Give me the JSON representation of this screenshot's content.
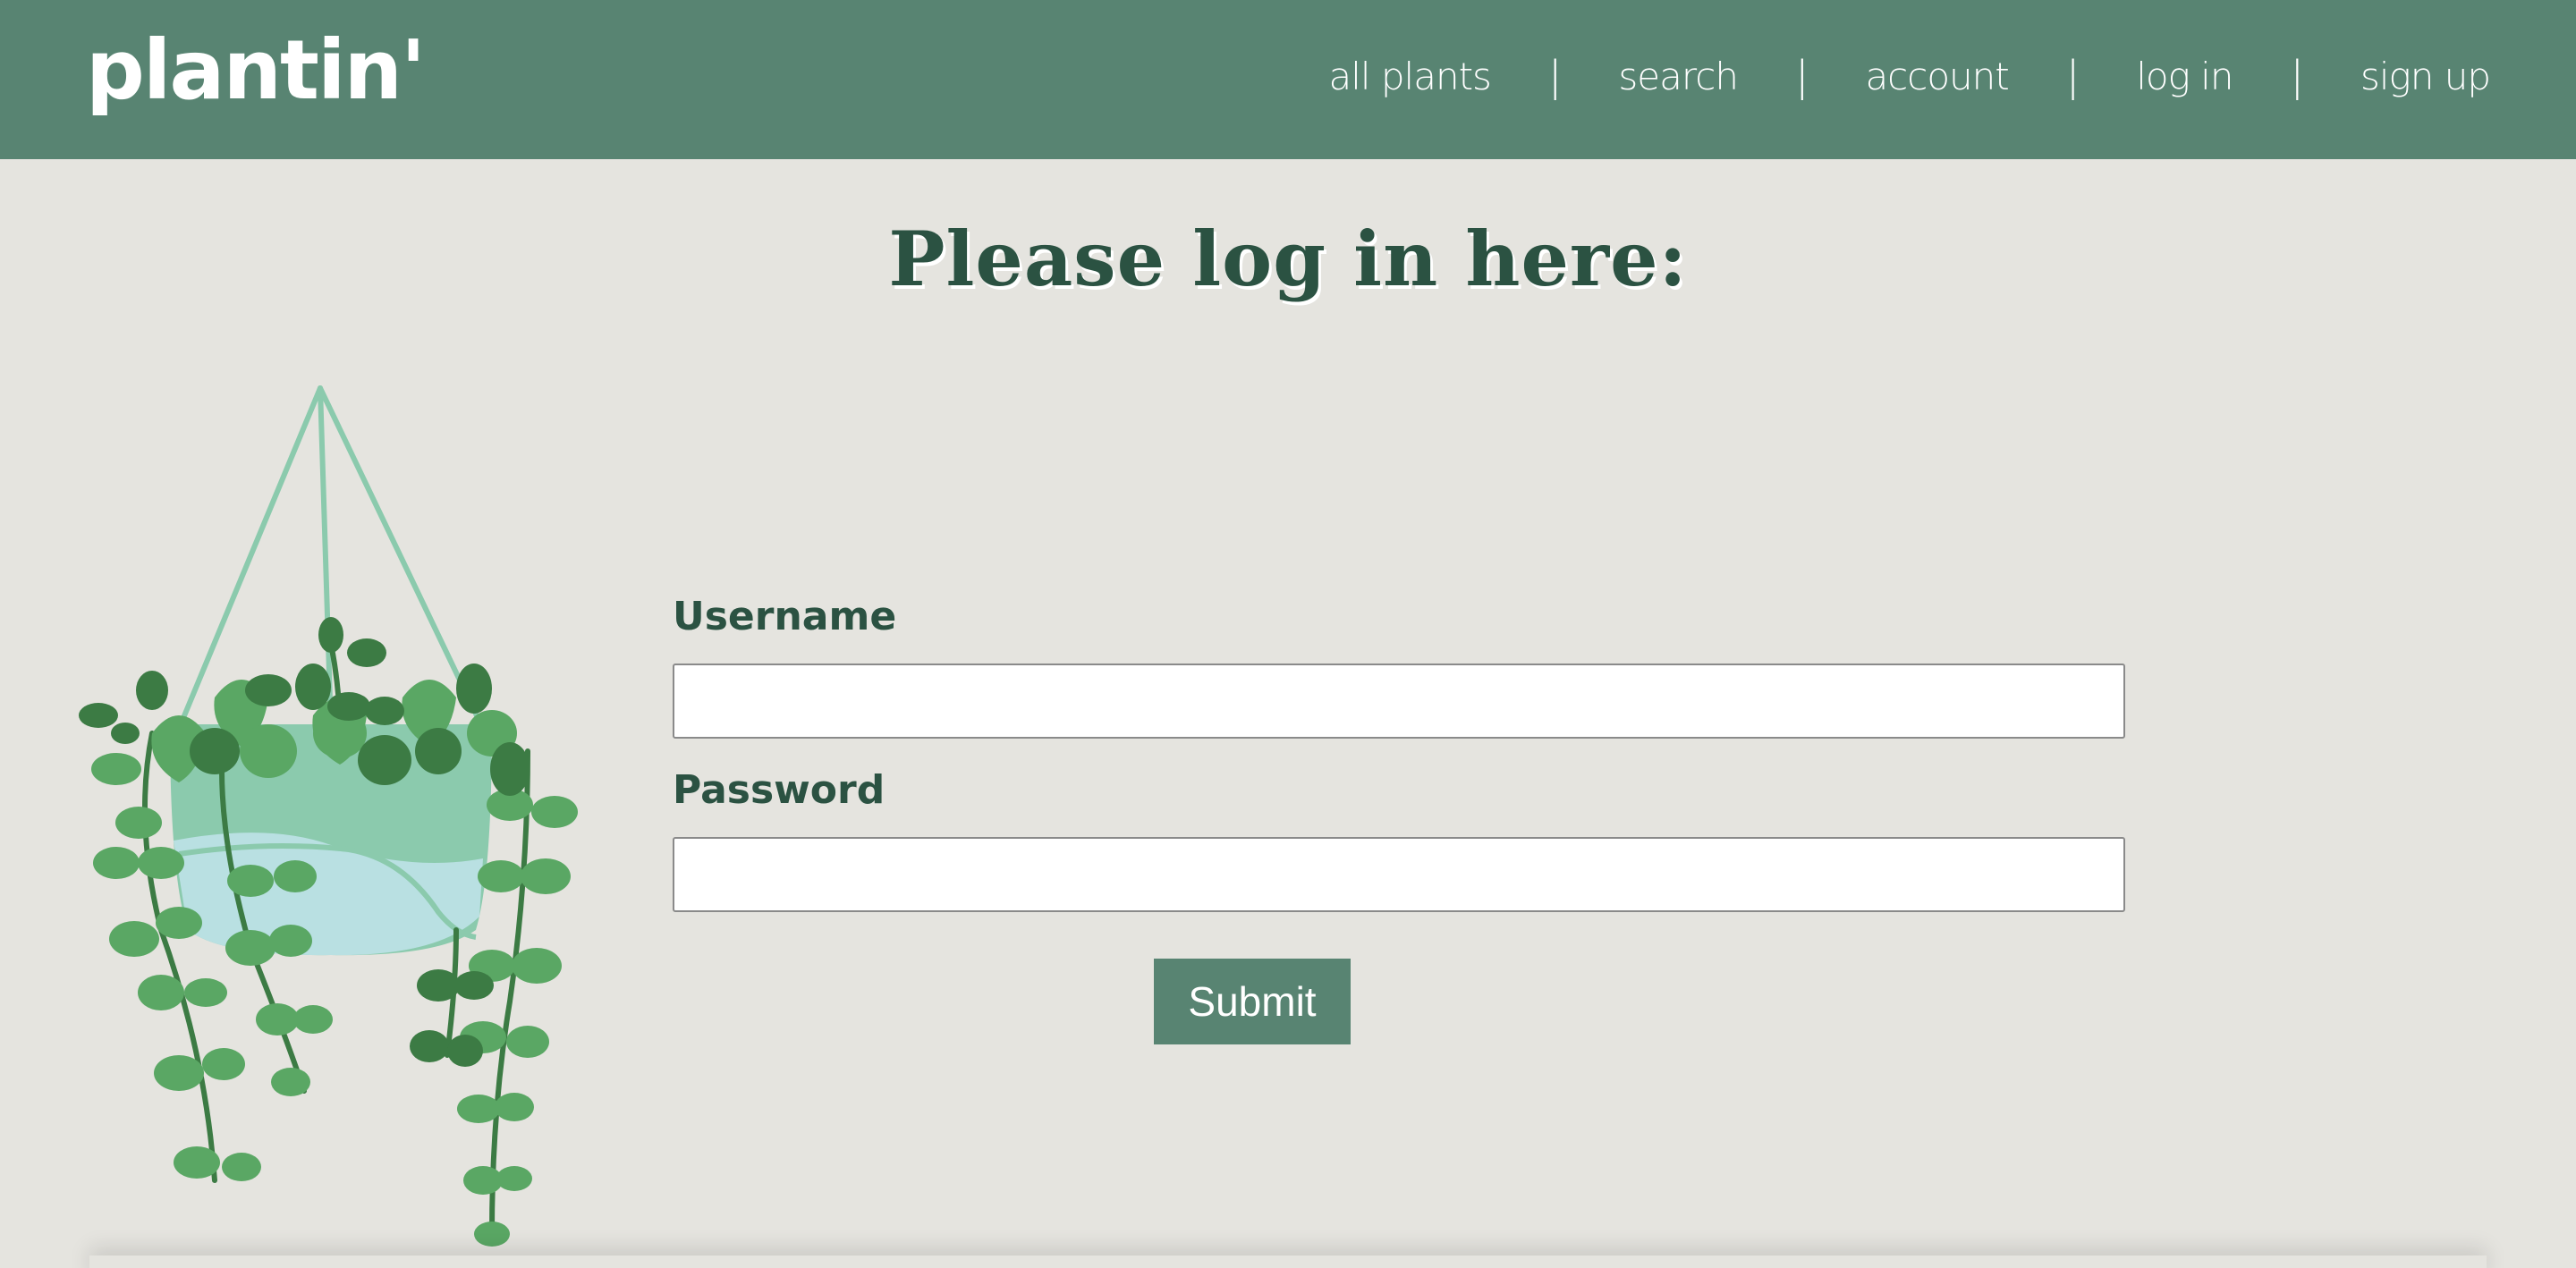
{
  "header": {
    "logo": "plantin'",
    "nav": [
      {
        "label": "all plants"
      },
      {
        "label": "search"
      },
      {
        "label": "account"
      },
      {
        "label": "log in"
      },
      {
        "label": "sign up"
      }
    ],
    "separator": "|"
  },
  "main": {
    "title": "Please log in here:",
    "form": {
      "username_label": "Username",
      "username_value": "",
      "password_label": "Password",
      "password_value": "",
      "submit_label": "Submit"
    }
  },
  "icons": {
    "plant": "hanging-plant-illustration"
  },
  "colors": {
    "header_bg": "#588472",
    "page_bg": "#e5e4df",
    "title": "#2b5242",
    "button_bg": "#588472",
    "pot": "#8bcaad",
    "pot_lower": "#b9e0e2",
    "leaf_light": "#5aa764",
    "leaf_dark": "#3c7b44",
    "string": "#8bcaad"
  }
}
